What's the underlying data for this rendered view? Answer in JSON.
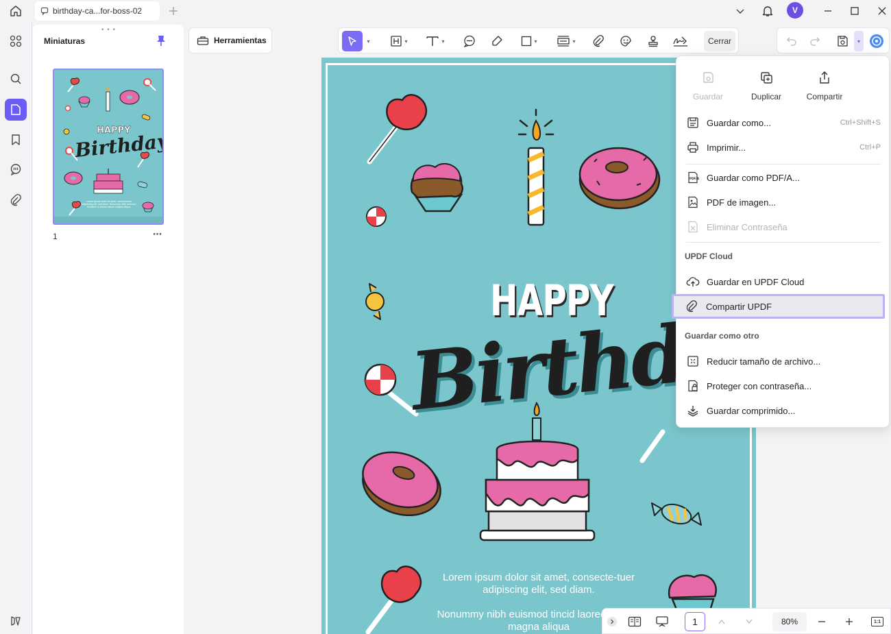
{
  "titlebar": {
    "tab_title": "birthday-ca...for-boss-02",
    "avatar_letter": "V"
  },
  "thumbnails": {
    "title": "Miniaturas",
    "grip": "• • •",
    "page_number": "1",
    "more": "⋯",
    "mini_happy": "HAPPY",
    "mini_birthday": "Birthday",
    "mini_lorem": "Lorem ipsum dolor sit amet, consectetuer adipiscing elit, sed diam. Nonummy nibh euismod tincidunt ut laoreet dolore magna aliqua."
  },
  "toolbar": {
    "tools_label": "Herramientas",
    "close_label": "Cerrar"
  },
  "document": {
    "happy": "HAPPY",
    "birthday": "Birthday",
    "lorem1": "Lorem ipsum dolor sit amet, consecte-tuer adipiscing elit, sed diam.",
    "lorem2": "Nonummy nibh euismod tincid laoreet dolore magna aliqua"
  },
  "menu": {
    "quick": [
      {
        "label": "Guardar",
        "disabled": true
      },
      {
        "label": "Duplicar",
        "disabled": false
      },
      {
        "label": "Compartir",
        "disabled": false
      }
    ],
    "items": [
      {
        "label": "Guardar como...",
        "shortcut": "Ctrl+Shift+S"
      },
      {
        "label": "Imprimir...",
        "shortcut": "Ctrl+P"
      },
      {
        "label": "Guardar como PDF/A..."
      },
      {
        "label": "PDF de imagen..."
      },
      {
        "label": "Eliminar Contraseña",
        "disabled": true
      },
      {
        "label": "Guardar en UPDF Cloud"
      },
      {
        "label": "Compartir UPDF"
      },
      {
        "label": "Reducir tamaño de archivo..."
      },
      {
        "label": "Proteger con contraseña..."
      },
      {
        "label": "Guardar comprimido..."
      }
    ],
    "section_cloud": "UPDF Cloud",
    "section_other": "Guardar como otro"
  },
  "bottombar": {
    "page": "1",
    "zoom": "80%",
    "fit": "1:1"
  },
  "colors": {
    "accent": "#6b5cf5",
    "page_bg": "#7bc6cc",
    "highlight_border": "#b9b3f7"
  }
}
